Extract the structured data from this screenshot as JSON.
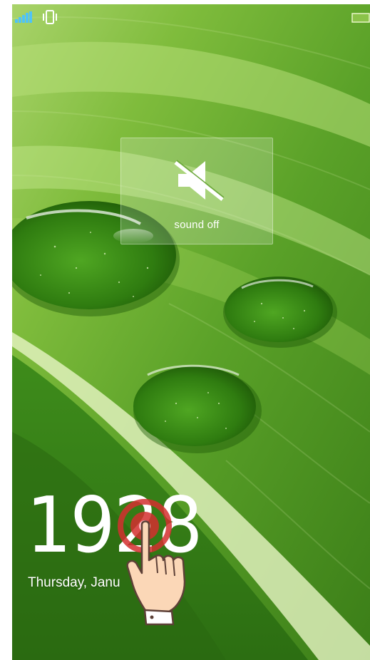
{
  "status_bar": {
    "signal_icon": "signal-bars-icon",
    "vibrate_icon": "vibrate-icon",
    "battery_icon": "battery-icon",
    "accent_color": "#4fc3f7"
  },
  "toast": {
    "icon": "speaker-muted-icon",
    "label": "sound off"
  },
  "lock_screen": {
    "time_digits": [
      "1",
      "9",
      "2",
      "8"
    ],
    "date_label": "Thursday, Janu"
  },
  "overlay": {
    "hint_icon": "tap-hand-icon",
    "target_color": "#d32f2f"
  },
  "wallpaper": {
    "subject": "green leaf with water droplets",
    "base_color": "#3f8a1c"
  }
}
